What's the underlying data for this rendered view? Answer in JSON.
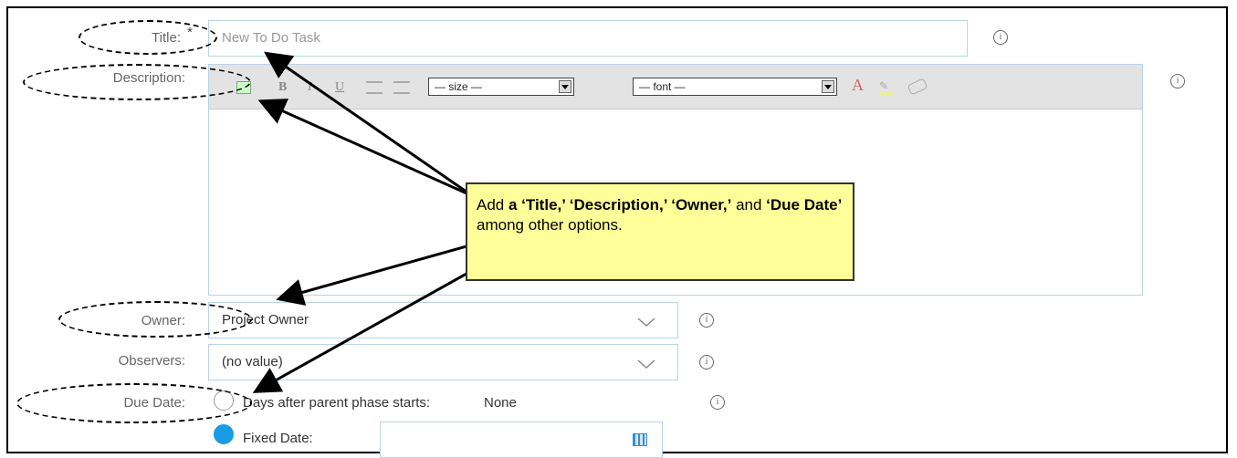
{
  "form": {
    "title_label": "Title:",
    "title_required": "*",
    "title_placeholder": "New To Do Task",
    "description_label": "Description:",
    "toolbar": {
      "bold": "B",
      "italic": "I",
      "underline": "U",
      "size": "— size —",
      "font": "— font —"
    },
    "owner_label": "Owner:",
    "owner_value": "Project Owner",
    "observers_label": "Observers:",
    "observers_value": "(no value)",
    "due_date_label": "Due Date:",
    "due_option_relative": "Days after parent phase starts:",
    "due_option_relative_value": "None",
    "due_option_fixed": "Fixed Date:",
    "due_selected": "fixed"
  },
  "callout": {
    "prefix": "Add ",
    "bold1": "a ‘Title,’ ‘Description,’ ‘Owner,’",
    "mid": " and ",
    "bold2": "‘Due Date’",
    "suffix": " among other options."
  },
  "colors": {
    "accent": "#1a9be6",
    "input_border": "#b8d4e8",
    "callout_bg": "#ffff99"
  },
  "icons": [
    "info-icon",
    "chevron-down-icon",
    "calendar-icon",
    "text-color-icon",
    "highlight-icon",
    "eraser-icon",
    "bullet-list-icon",
    "numbered-list-icon",
    "image-icon"
  ]
}
